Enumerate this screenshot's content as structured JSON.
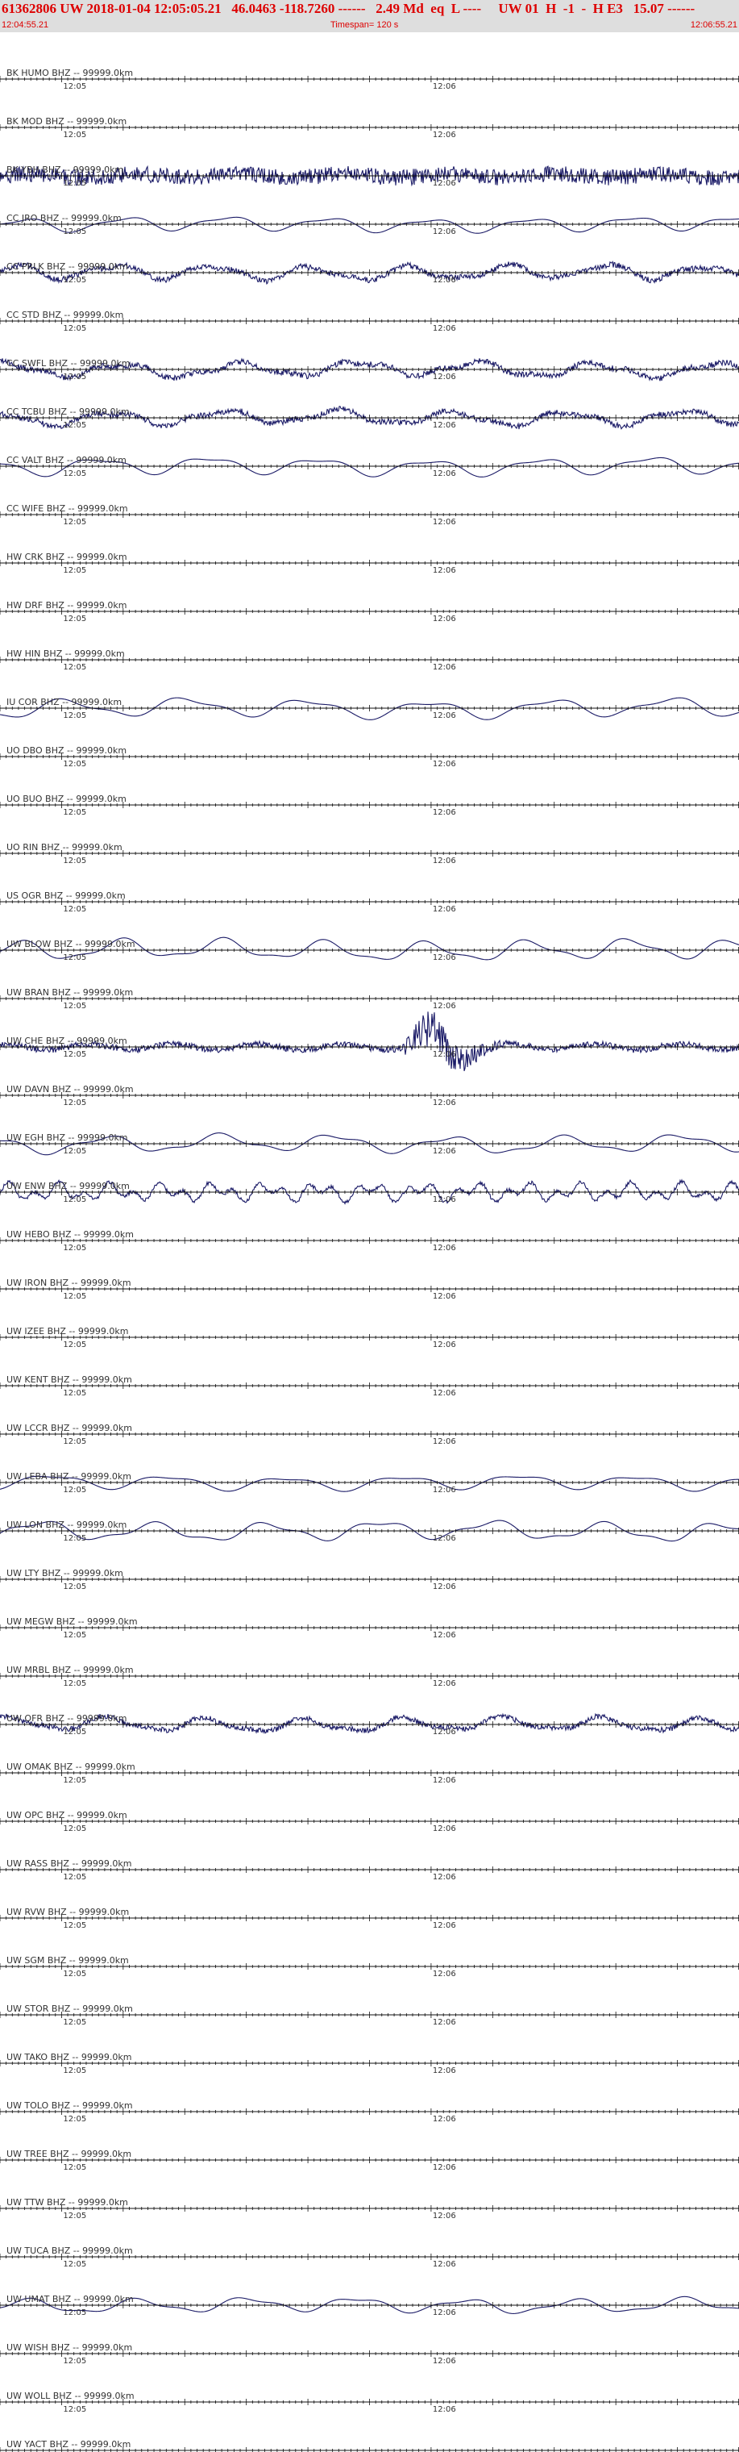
{
  "header": {
    "title": "61362806 UW 2018-01-04 12:05:05.21   46.0463 -118.7260 ------   2.49 Md  eq  L ----     UW 01  H  -1  -  H E3   15.07 ------",
    "start_time": "12:04:55.21",
    "timespan": "Timespan= 120 s",
    "end_time": "12:06:55.21"
  },
  "colors": {
    "header_bg": "#dedede",
    "header_text": "#dd0000",
    "trace": "#1a1a66",
    "axis": "#111111"
  },
  "chart_data": {
    "type": "line",
    "x_unit": "s",
    "x_range": [
      0,
      120
    ],
    "x_start_time": "12:04:55.21",
    "tick_labels": [
      {
        "t": 10,
        "label": "12:05"
      },
      {
        "t": 70,
        "label": "12:06"
      }
    ],
    "channels": [
      {
        "label": "BK HUMO BHZ -- 99999.0km",
        "has_trace": false,
        "amp": 0,
        "style": "none"
      },
      {
        "label": "BK MOD BHZ -- 99999.0km",
        "has_trace": false,
        "amp": 0,
        "style": "none"
      },
      {
        "label": "BK YBH BHZ -- 99999.0km",
        "has_trace": true,
        "amp": 11,
        "style": "noise"
      },
      {
        "label": "CC JRO BHZ -- 99999.0km",
        "has_trace": true,
        "amp": 10,
        "style": "smooth"
      },
      {
        "label": "CC PRLK BHZ -- 99999.0km",
        "has_trace": true,
        "amp": 13,
        "style": "mixed"
      },
      {
        "label": "CC STD BHZ -- 99999.0km",
        "has_trace": false,
        "amp": 0,
        "style": "none"
      },
      {
        "label": "CC SWFL BHZ -- 99999.0km",
        "has_trace": true,
        "amp": 13,
        "style": "mixed"
      },
      {
        "label": "CC TCBU BHZ -- 99999.0km",
        "has_trace": true,
        "amp": 13,
        "style": "mixed"
      },
      {
        "label": "CC VALT BHZ -- 99999.0km",
        "has_trace": true,
        "amp": 12,
        "style": "smooth"
      },
      {
        "label": "CC WIFE BHZ -- 99999.0km",
        "has_trace": false,
        "amp": 0,
        "style": "none"
      },
      {
        "label": "HW CRK BHZ -- 99999.0km",
        "has_trace": false,
        "amp": 0,
        "style": "none"
      },
      {
        "label": "HW DRF BHZ -- 99999.0km",
        "has_trace": false,
        "amp": 0,
        "style": "none"
      },
      {
        "label": "HW HIN BHZ -- 99999.0km",
        "has_trace": false,
        "amp": 0,
        "style": "none"
      },
      {
        "label": "IU COR BHZ -- 99999.0km",
        "has_trace": true,
        "amp": 13,
        "style": "smooth"
      },
      {
        "label": "UO DBO BHZ -- 99999.0km",
        "has_trace": false,
        "amp": 0,
        "style": "none"
      },
      {
        "label": "UO BUO BHZ -- 99999.0km",
        "has_trace": false,
        "amp": 0,
        "style": "none"
      },
      {
        "label": "UO RIN BHZ -- 99999.0km",
        "has_trace": false,
        "amp": 0,
        "style": "none"
      },
      {
        "label": "US OGR BHZ -- 99999.0km",
        "has_trace": false,
        "amp": 0,
        "style": "none"
      },
      {
        "label": "UW BLOW BHZ -- 99999.0km",
        "has_trace": true,
        "amp": 14,
        "style": "smooth"
      },
      {
        "label": "UW BRAN BHZ -- 99999.0km",
        "has_trace": false,
        "amp": 0,
        "style": "none"
      },
      {
        "label": "UW CHE BHZ -- 99999.0km",
        "has_trace": true,
        "amp": 7,
        "style": "quake"
      },
      {
        "label": "UW DAVN BHZ -- 99999.0km",
        "has_trace": false,
        "amp": 0,
        "style": "none"
      },
      {
        "label": "UW EGH BHZ -- 99999.0km",
        "has_trace": true,
        "amp": 12,
        "style": "smooth"
      },
      {
        "label": "UW ENW BHZ -- 99999.0km",
        "has_trace": true,
        "amp": 13,
        "style": "jagged"
      },
      {
        "label": "UW HEBO BHZ -- 99999.0km",
        "has_trace": false,
        "amp": 0,
        "style": "none"
      },
      {
        "label": "UW IRON BHZ -- 99999.0km",
        "has_trace": false,
        "amp": 0,
        "style": "none"
      },
      {
        "label": "UW IZEE BHZ -- 99999.0km",
        "has_trace": false,
        "amp": 0,
        "style": "none"
      },
      {
        "label": "UW KENT BHZ -- 99999.0km",
        "has_trace": false,
        "amp": 0,
        "style": "none"
      },
      {
        "label": "UW LCCR BHZ -- 99999.0km",
        "has_trace": false,
        "amp": 0,
        "style": "none"
      },
      {
        "label": "UW LEBA BHZ -- 99999.0km",
        "has_trace": true,
        "amp": 10,
        "style": "smooth"
      },
      {
        "label": "UW LON BHZ -- 99999.0km",
        "has_trace": true,
        "amp": 13,
        "style": "smooth"
      },
      {
        "label": "UW LTY BHZ -- 99999.0km",
        "has_trace": false,
        "amp": 0,
        "style": "none"
      },
      {
        "label": "UW MEGW BHZ -- 99999.0km",
        "has_trace": false,
        "amp": 0,
        "style": "none"
      },
      {
        "label": "UW MRBL BHZ -- 99999.0km",
        "has_trace": false,
        "amp": 0,
        "style": "none"
      },
      {
        "label": "UW OFR BHZ -- 99999.0km",
        "has_trace": true,
        "amp": 12,
        "style": "mixed"
      },
      {
        "label": "UW OMAK BHZ -- 99999.0km",
        "has_trace": false,
        "amp": 0,
        "style": "none"
      },
      {
        "label": "UW OPC BHZ -- 99999.0km",
        "has_trace": false,
        "amp": 0,
        "style": "none"
      },
      {
        "label": "UW RASS BHZ -- 99999.0km",
        "has_trace": false,
        "amp": 0,
        "style": "none"
      },
      {
        "label": "UW RVW BHZ -- 99999.0km",
        "has_trace": false,
        "amp": 0,
        "style": "none"
      },
      {
        "label": "UW SGM BHZ -- 99999.0km",
        "has_trace": false,
        "amp": 0,
        "style": "none"
      },
      {
        "label": "UW STOR BHZ -- 99999.0km",
        "has_trace": false,
        "amp": 0,
        "style": "none"
      },
      {
        "label": "UW TAKO BHZ -- 99999.0km",
        "has_trace": false,
        "amp": 0,
        "style": "none"
      },
      {
        "label": "UW TOLO BHZ -- 99999.0km",
        "has_trace": false,
        "amp": 0,
        "style": "none"
      },
      {
        "label": "UW TREE BHZ -- 99999.0km",
        "has_trace": false,
        "amp": 0,
        "style": "none"
      },
      {
        "label": "UW TTW BHZ -- 99999.0km",
        "has_trace": false,
        "amp": 0,
        "style": "none"
      },
      {
        "label": "UW TUCA BHZ -- 99999.0km",
        "has_trace": false,
        "amp": 0,
        "style": "none"
      },
      {
        "label": "UW UMAT BHZ -- 99999.0km",
        "has_trace": true,
        "amp": 10,
        "style": "smooth"
      },
      {
        "label": "UW WISH BHZ -- 99999.0km",
        "has_trace": false,
        "amp": 0,
        "style": "none"
      },
      {
        "label": "UW WOLL BHZ -- 99999.0km",
        "has_trace": false,
        "amp": 0,
        "style": "none"
      },
      {
        "label": "UW YACT BHZ -- 99999.0km",
        "has_trace": false,
        "amp": 0,
        "style": "none"
      }
    ]
  }
}
